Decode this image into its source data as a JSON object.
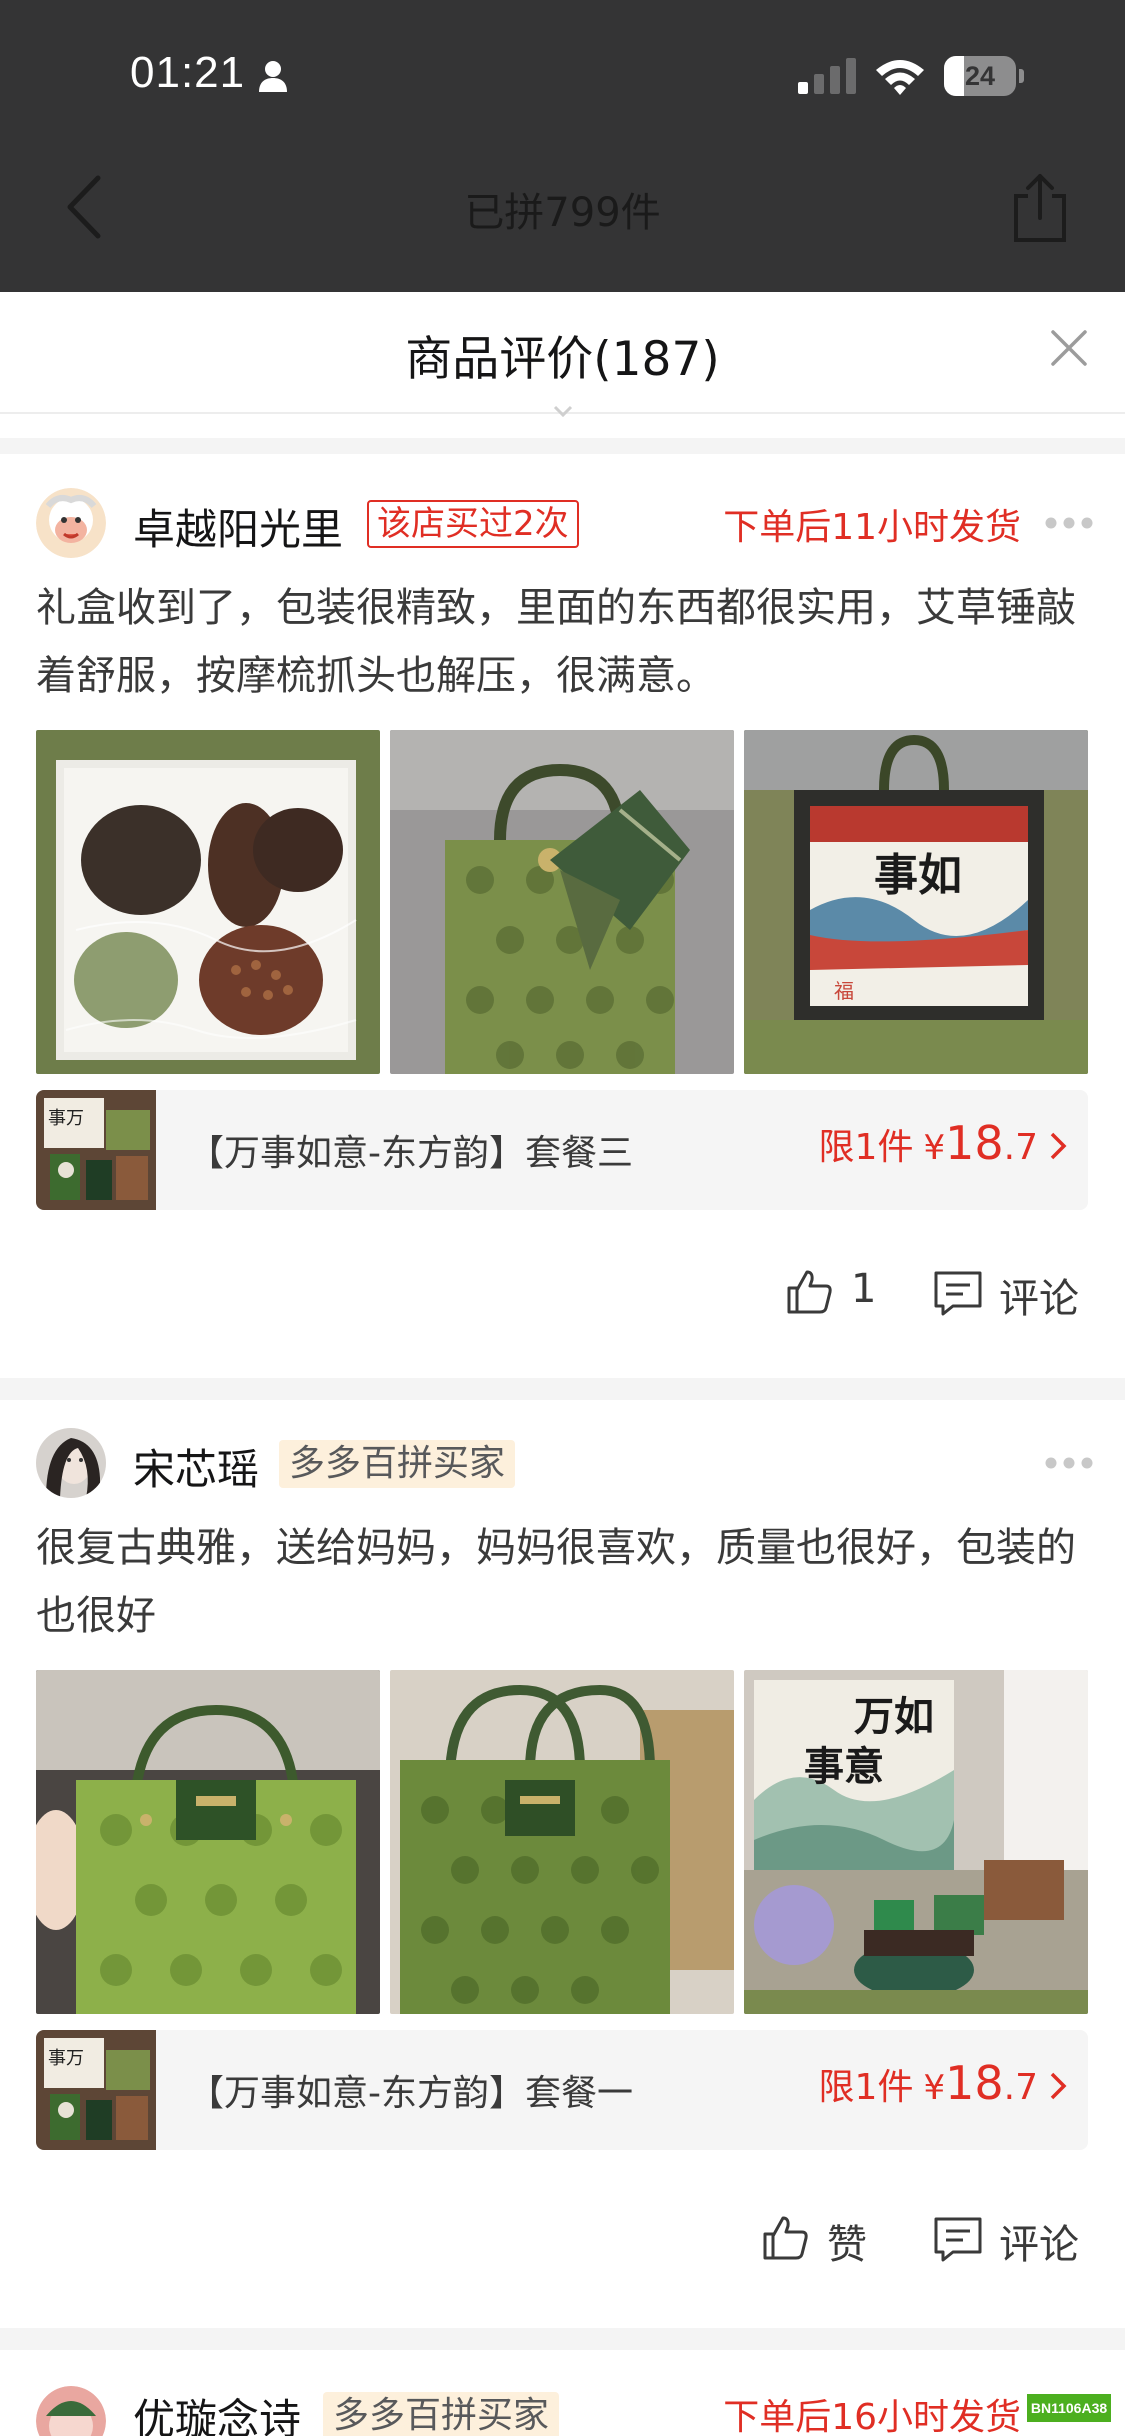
{
  "status_bar": {
    "time": "01:21",
    "battery": "24"
  },
  "background_page": {
    "title": "已拼799件"
  },
  "sheet": {
    "title": "商品评价(187)"
  },
  "reviews": [
    {
      "user": "卓越阳光里",
      "badge": "该店买过2次",
      "shipping_note": "下单后11小时发货",
      "text": "礼盒收到了，包装很精致，里面的东西都很实用，艾草锤敲着舒服，按摩梳抓头也解压，很满意。",
      "product": {
        "name": "【万事如意-东方韵】套餐三",
        "limit": "限1件",
        "currency": "¥",
        "price_int": "18",
        "price_dec": ".7"
      },
      "like_count": "1",
      "comment_label": "评论"
    },
    {
      "user": "宋芯瑶",
      "badge": "多多百拼买家",
      "text": "很复古典雅，送给妈妈，妈妈很喜欢，质量也很好，包装的也很好",
      "product": {
        "name": "【万事如意-东方韵】套餐一",
        "limit": "限1件",
        "currency": "¥",
        "price_int": "18",
        "price_dec": ".7"
      },
      "like_label": "赞",
      "comment_label": "评论"
    },
    {
      "user": "优璇念诗",
      "badge": "多多百拼买家",
      "shipping_note": "下单后16小时发货"
    }
  ],
  "photo_text": {
    "box_card": "万事如意",
    "stamp": "福"
  },
  "watermark": "BN1106A38",
  "colors": {
    "accent_red": "#e02e24",
    "badge_gold_bg": "#fdf0dc",
    "bag_green": "#6f8a3c"
  }
}
